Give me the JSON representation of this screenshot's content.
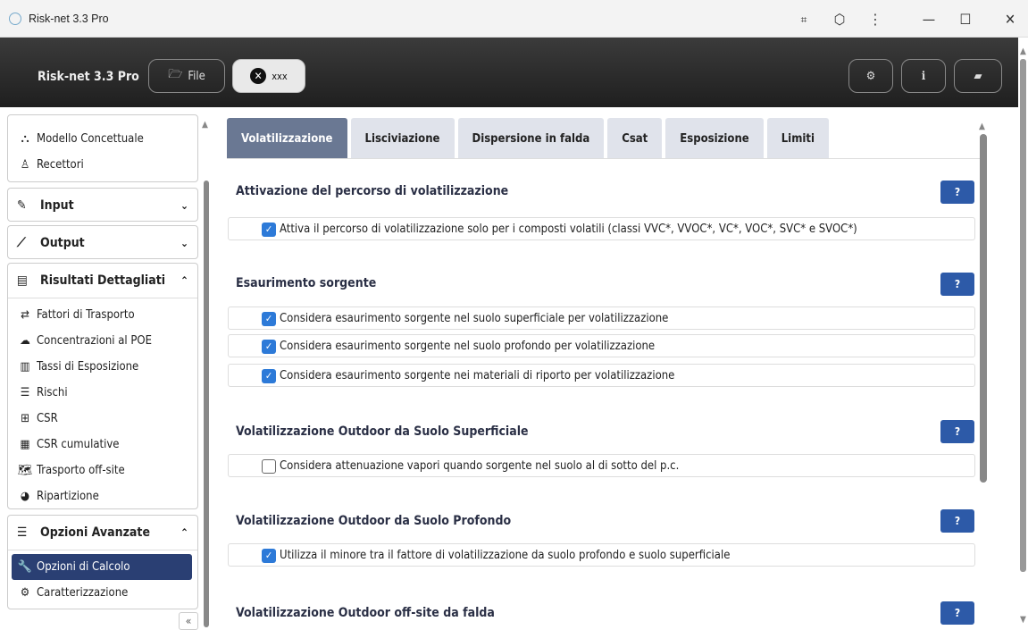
{
  "window": {
    "title": "Risk-net 3.3 Pro"
  },
  "header": {
    "brand": "Risk-net 3.3 Pro",
    "file_label": "File",
    "project_label": "xxx"
  },
  "sidebar": {
    "top_items": [
      {
        "label": "Modello Concettuale"
      },
      {
        "label": "Recettori"
      }
    ],
    "input_label": "Input",
    "output_label": "Output",
    "results": {
      "label": "Risultati Dettagliati",
      "items": [
        {
          "label": "Fattori di Trasporto"
        },
        {
          "label": "Concentrazioni al POE"
        },
        {
          "label": "Tassi di Esposizione"
        },
        {
          "label": "Rischi"
        },
        {
          "label": "CSR"
        },
        {
          "label": "CSR cumulative"
        },
        {
          "label": "Trasporto off-site"
        },
        {
          "label": "Ripartizione"
        }
      ]
    },
    "advanced": {
      "label": "Opzioni Avanzate",
      "items": [
        {
          "label": "Opzioni di Calcolo"
        },
        {
          "label": "Caratterizzazione"
        }
      ]
    },
    "collapse_label": "«"
  },
  "tabs": [
    {
      "label": "Volatilizzazione"
    },
    {
      "label": "Lisciviazione"
    },
    {
      "label": "Dispersione in falda"
    },
    {
      "label": "Csat"
    },
    {
      "label": "Esposizione"
    },
    {
      "label": "Limiti"
    }
  ],
  "sections": [
    {
      "title": "Attivazione del percorso di volatilizzazione",
      "help": "?",
      "options": [
        {
          "label": "Attiva il percorso di volatilizzazione solo per i composti volatili (classi VVC*, VVOC*, VC*, VOC*, SVC* e SVOC*)",
          "checked": true
        }
      ]
    },
    {
      "title": "Esaurimento sorgente",
      "help": "?",
      "options": [
        {
          "label": "Considera esaurimento sorgente nel suolo superficiale per volatilizzazione",
          "checked": true
        },
        {
          "label": "Considera esaurimento sorgente nel suolo profondo per volatilizzazione",
          "checked": true
        },
        {
          "label": "Considera esaurimento sorgente nei materiali di riporto per volatilizzazione",
          "checked": true
        }
      ]
    },
    {
      "title": "Volatilizzazione Outdoor da Suolo Superficiale",
      "help": "?",
      "options": [
        {
          "label": "Considera attenuazione vapori quando sorgente nel suolo al di sotto del p.c.",
          "checked": false
        }
      ]
    },
    {
      "title": "Volatilizzazione Outdoor da Suolo Profondo",
      "help": "?",
      "options": [
        {
          "label": "Utilizza il minore tra il fattore di volatilizzazione da suolo profondo e suolo superficiale",
          "checked": true
        }
      ]
    },
    {
      "title": "Volatilizzazione Outdoor off-site da falda",
      "help": "?",
      "options": []
    }
  ]
}
